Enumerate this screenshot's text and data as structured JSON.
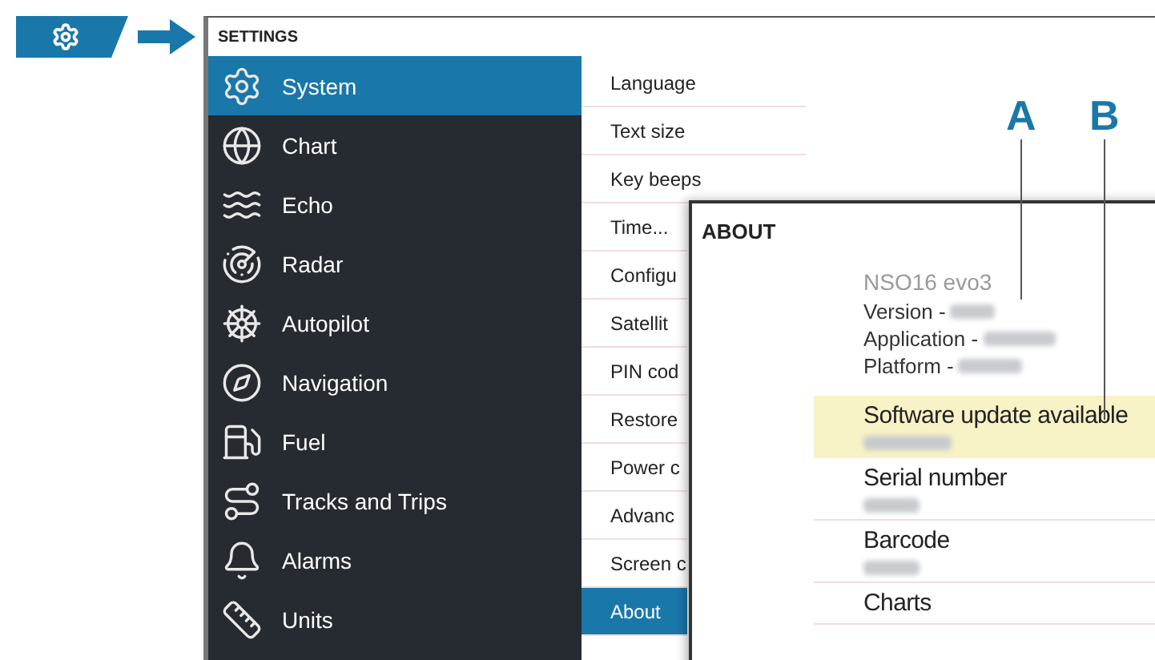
{
  "settings": {
    "title": "SETTINGS",
    "categories": [
      {
        "label": "System",
        "selected": true
      },
      {
        "label": "Chart",
        "selected": false
      },
      {
        "label": "Echo",
        "selected": false
      },
      {
        "label": "Radar",
        "selected": false
      },
      {
        "label": "Autopilot",
        "selected": false
      },
      {
        "label": "Navigation",
        "selected": false
      },
      {
        "label": "Fuel",
        "selected": false
      },
      {
        "label": "Tracks and Trips",
        "selected": false
      },
      {
        "label": "Alarms",
        "selected": false
      },
      {
        "label": "Units",
        "selected": false
      }
    ],
    "options": [
      {
        "label": "Language",
        "selected": false
      },
      {
        "label": "Text size",
        "selected": false
      },
      {
        "label": "Key beeps",
        "selected": false
      },
      {
        "label": "Time...",
        "selected": false
      },
      {
        "label": "Configu",
        "selected": false
      },
      {
        "label": "Satellit",
        "selected": false
      },
      {
        "label": "PIN cod",
        "selected": false
      },
      {
        "label": "Restore",
        "selected": false
      },
      {
        "label": "Power c",
        "selected": false
      },
      {
        "label": "Advanc",
        "selected": false
      },
      {
        "label": "Screen c",
        "selected": false
      },
      {
        "label": "About",
        "selected": true
      }
    ]
  },
  "about": {
    "title": "ABOUT",
    "device": "NSO16 evo3",
    "info": [
      {
        "label": "Version -"
      },
      {
        "label": "Application -"
      },
      {
        "label": "Platform -"
      }
    ],
    "items": [
      {
        "title": "Software update available",
        "highlighted": true
      },
      {
        "title": "Serial number",
        "highlighted": false
      },
      {
        "title": "Barcode",
        "highlighted": false
      },
      {
        "title": "Charts",
        "highlighted": false
      }
    ]
  },
  "callouts": [
    {
      "label": "A"
    },
    {
      "label": "B"
    }
  ]
}
